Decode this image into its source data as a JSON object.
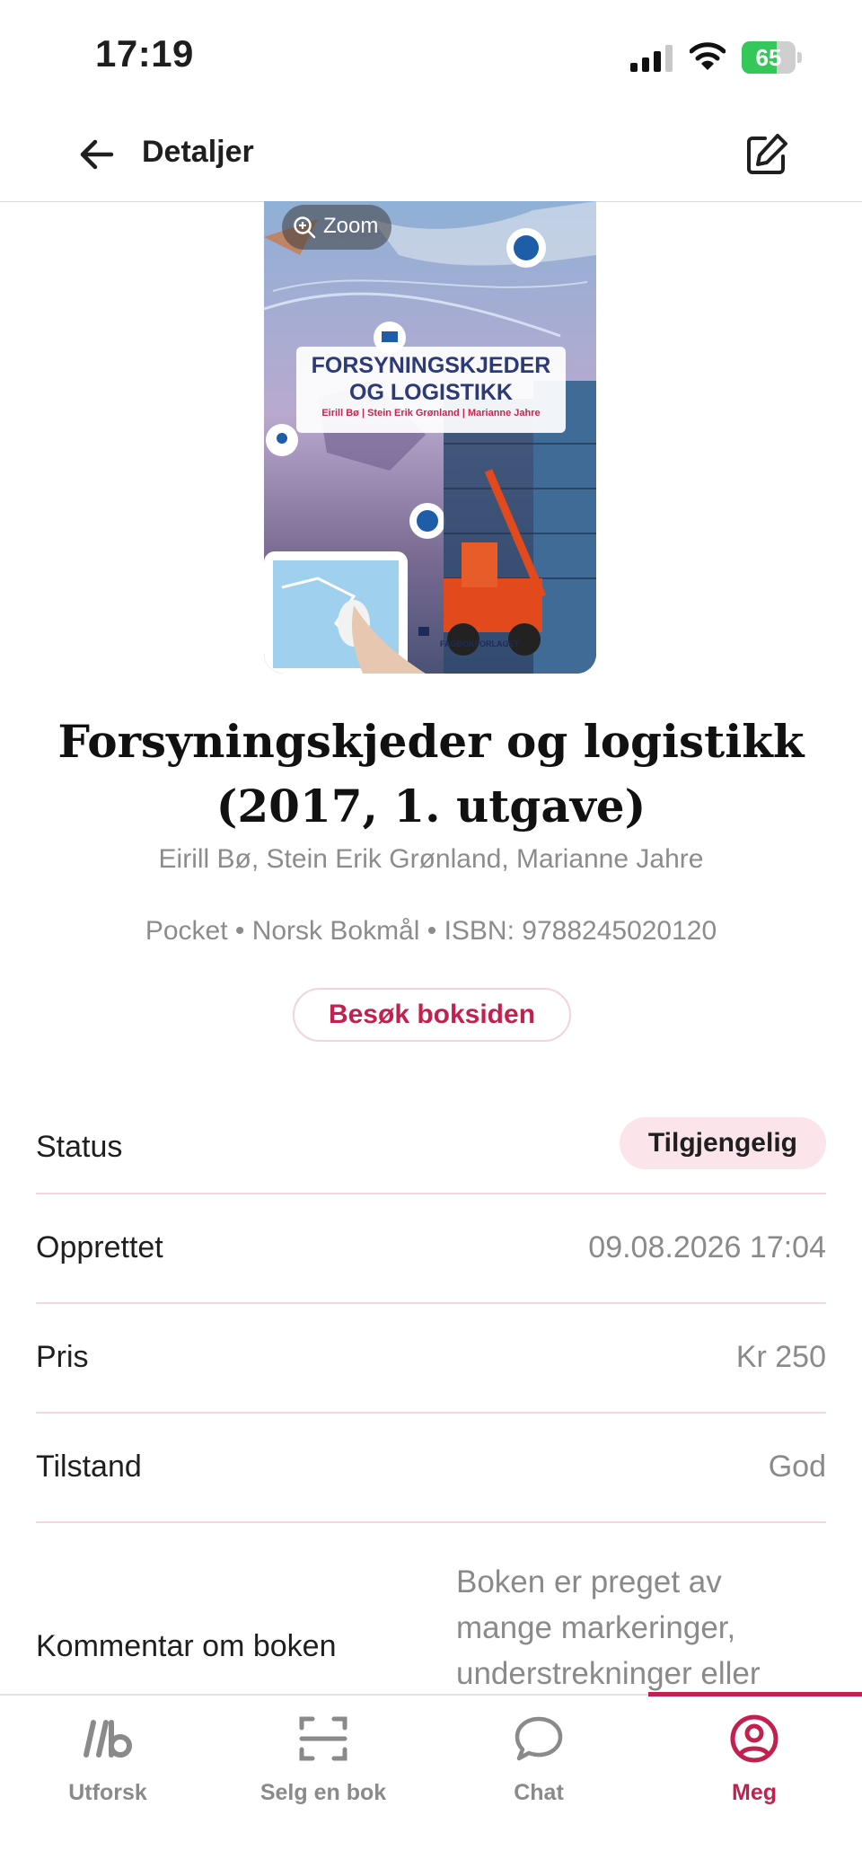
{
  "status_bar": {
    "time": "17:19",
    "battery": "65",
    "battery_level": 0.65
  },
  "header": {
    "title": "Detaljer"
  },
  "cover": {
    "zoom_label": "Zoom",
    "title_line1": "FORSYNINGSKJEDER",
    "title_line2": "OG LOGISTIKK",
    "authors": "Eirill Bø | Stein Erik Grønland | Marianne Jahre",
    "publisher": "FAGBOKFORLAGET"
  },
  "book": {
    "title_line1": "Forsyningskjeder og logistikk",
    "title_line2": "(2017, 1. utgave)",
    "authors": "Eirill Bø, Stein Erik Grønland, Marianne Jahre",
    "meta": "Pocket • Norsk Bokmål • ISBN: 9788245020120",
    "visit_label": "Besøk boksiden"
  },
  "details": {
    "status": {
      "label": "Status",
      "value": "Tilgjengelig"
    },
    "created": {
      "label": "Opprettet",
      "value": "09.08.2026 17:04"
    },
    "price": {
      "label": "Pris",
      "value": "Kr 250"
    },
    "condition": {
      "label": "Tilstand",
      "value": "God"
    },
    "comment": {
      "label": "Kommentar om boken",
      "value": "Boken er preget av mange markeringer, understrekninger eller"
    }
  },
  "tabs": [
    {
      "label": "Utforsk",
      "icon": "brand-lb-icon"
    },
    {
      "label": "Selg en bok",
      "icon": "scan-icon"
    },
    {
      "label": "Chat",
      "icon": "chat-bubble-icon"
    },
    {
      "label": "Meg",
      "icon": "user-circle-icon",
      "active": true
    }
  ],
  "colors": {
    "accent": "#c2214f",
    "badge_bg": "#fbe4ea",
    "divider": "#f5d6df"
  }
}
